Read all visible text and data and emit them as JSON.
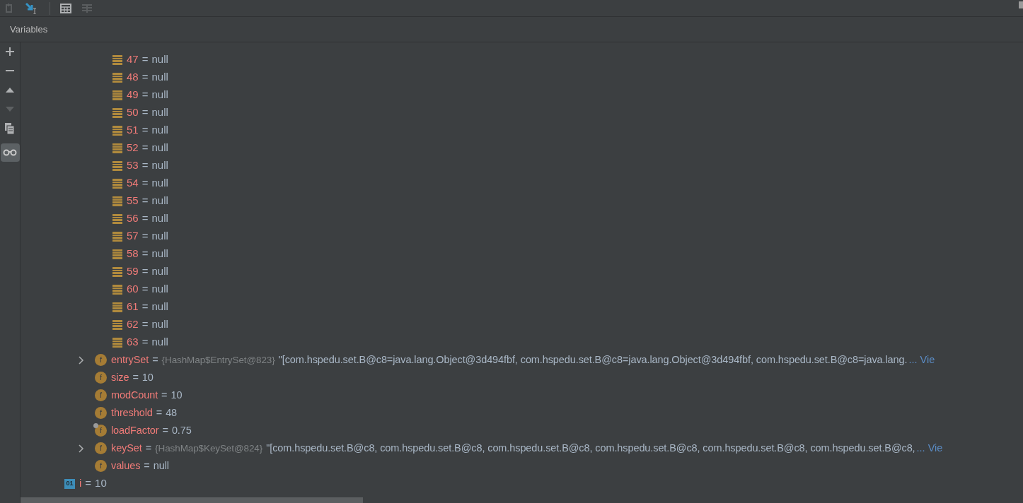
{
  "panel_title": "Variables",
  "array_items": [
    {
      "index": "47",
      "eq": "=",
      "value": "null"
    },
    {
      "index": "48",
      "eq": "=",
      "value": "null"
    },
    {
      "index": "49",
      "eq": "=",
      "value": "null"
    },
    {
      "index": "50",
      "eq": "=",
      "value": "null"
    },
    {
      "index": "51",
      "eq": "=",
      "value": "null"
    },
    {
      "index": "52",
      "eq": "=",
      "value": "null"
    },
    {
      "index": "53",
      "eq": "=",
      "value": "null"
    },
    {
      "index": "54",
      "eq": "=",
      "value": "null"
    },
    {
      "index": "55",
      "eq": "=",
      "value": "null"
    },
    {
      "index": "56",
      "eq": "=",
      "value": "null"
    },
    {
      "index": "57",
      "eq": "=",
      "value": "null"
    },
    {
      "index": "58",
      "eq": "=",
      "value": "null"
    },
    {
      "index": "59",
      "eq": "=",
      "value": "null"
    },
    {
      "index": "60",
      "eq": "=",
      "value": "null"
    },
    {
      "index": "61",
      "eq": "=",
      "value": "null"
    },
    {
      "index": "62",
      "eq": "=",
      "value": "null"
    },
    {
      "index": "63",
      "eq": "=",
      "value": "null"
    }
  ],
  "fields": [
    {
      "icon": "f",
      "name": "entrySet",
      "eq": "=",
      "expandable": true,
      "overlay_mark": false,
      "type_info": "{HashMap$EntrySet@823}",
      "value": "\"[com.hspedu.set.B@c8=java.lang.Object@3d494fbf, com.hspedu.set.B@c8=java.lang.Object@3d494fbf, com.hspedu.set.B@c8=java.lang.",
      "link": "... Vie"
    },
    {
      "icon": "f",
      "name": "size",
      "eq": "=",
      "expandable": false,
      "overlay_mark": false,
      "value": "10"
    },
    {
      "icon": "f",
      "name": "modCount",
      "eq": "=",
      "expandable": false,
      "overlay_mark": false,
      "value": "10"
    },
    {
      "icon": "f",
      "name": "threshold",
      "eq": "=",
      "expandable": false,
      "overlay_mark": false,
      "value": "48"
    },
    {
      "icon": "f",
      "name": "loadFactor",
      "eq": "=",
      "expandable": false,
      "overlay_mark": true,
      "value": "0.75"
    },
    {
      "icon": "f",
      "name": "keySet",
      "eq": "=",
      "expandable": true,
      "overlay_mark": false,
      "type_info": "{HashMap$KeySet@824}",
      "value": "\"[com.hspedu.set.B@c8, com.hspedu.set.B@c8, com.hspedu.set.B@c8, com.hspedu.set.B@c8, com.hspedu.set.B@c8, com.hspedu.set.B@c8,",
      "link": "... Vie"
    },
    {
      "icon": "f",
      "name": "values",
      "eq": "=",
      "expandable": false,
      "overlay_mark": false,
      "value": "null"
    }
  ],
  "locals": [
    {
      "icon": "01",
      "name": "i",
      "eq": "=",
      "value": "10"
    }
  ]
}
